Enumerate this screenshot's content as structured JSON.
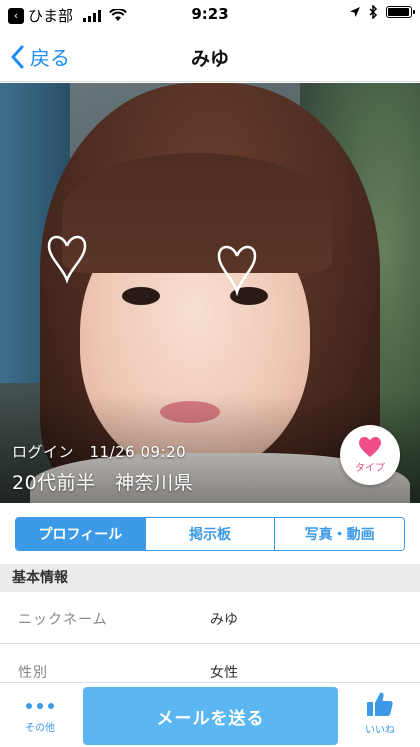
{
  "status_bar": {
    "back_app": "ひま部",
    "time": "9:23",
    "battery_level": 0.95
  },
  "nav": {
    "back_label": "戻る",
    "title": "みゆ"
  },
  "profile": {
    "login": "ログイン　11/26 09:20",
    "area": "20代前半　神奈川県",
    "type_label": "タイプ"
  },
  "tabs": [
    {
      "label": "プロフィール",
      "active": true
    },
    {
      "label": "掲示板",
      "active": false
    },
    {
      "label": "写真・動画",
      "active": false
    }
  ],
  "basic_info": {
    "header": "基本情報",
    "rows": [
      {
        "label": "ニックネーム",
        "value": "みゆ"
      },
      {
        "label": "性別",
        "value": "女性"
      }
    ]
  },
  "bottom_bar": {
    "other_label": "その他",
    "mail_button": "メールを送る",
    "like_label": "いいね"
  },
  "colors": {
    "accent": "#3d9ae8",
    "mail_button": "#5cb6f1",
    "heart": "#ee4d8a"
  },
  "icons": {
    "back_app": "chevron-left-icon",
    "wifi": "wifi-icon",
    "location": "location-arrow-icon",
    "bluetooth": "bluetooth-icon",
    "type": "heart-icon",
    "other": "more-dots-icon",
    "like": "thumbs-up-icon"
  }
}
